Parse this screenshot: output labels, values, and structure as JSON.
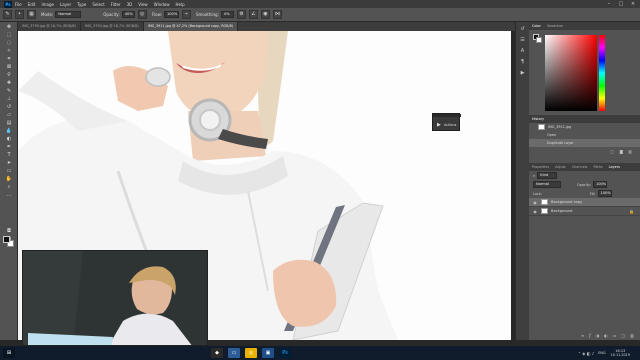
{
  "app": {
    "logo": "Ps",
    "menu": [
      "File",
      "Edit",
      "Image",
      "Layer",
      "Type",
      "Select",
      "Filter",
      "3D",
      "View",
      "Window",
      "Help"
    ]
  },
  "options_bar": {
    "mode_label": "Mode:",
    "mode_value": "Normal",
    "opacity_label": "Opacity:",
    "opacity_value": "40%",
    "flow_label": "Flow:",
    "flow_value": "100%",
    "smoothing_label": "Smoothing:",
    "smoothing_value": "0%"
  },
  "tabs": [
    {
      "label": "IMG_3799.jpg @ 16,7% (RGB/8)",
      "active": false
    },
    {
      "label": "IMG_3790.jpg @ 16,7% (RGB/8)",
      "active": false
    },
    {
      "label": "IMG_3911.jpg @ 47,2% (Background copy, RGB/8)",
      "active": true
    }
  ],
  "actions_popup": {
    "label": "Actions"
  },
  "panels": {
    "color_tabs": [
      "Color",
      "Swatches"
    ],
    "history_tabs": [
      "History"
    ],
    "history_items": [
      "IMG_3911.jpg",
      "Open",
      "Duplicate Layer"
    ],
    "layers_tabs": [
      "Properties",
      "Adjust",
      "Channels",
      "Paths",
      "Layers"
    ],
    "kind_label": "Kind",
    "blend_mode": "Normal",
    "opacity_label": "Opacity:",
    "opacity_value": "100%",
    "lock_label": "Lock:",
    "fill_label": "Fill:",
    "fill_value": "100%",
    "layers": [
      {
        "name": "Background copy",
        "selected": true
      },
      {
        "name": "Background",
        "selected": false
      }
    ]
  },
  "taskbar": {
    "language": "ENG",
    "time": "16:13",
    "date": "10.11.2019"
  },
  "colors": {
    "ps_blue": "#31a8ff",
    "taskbar": "#101c2c",
    "panel": "#535353"
  }
}
